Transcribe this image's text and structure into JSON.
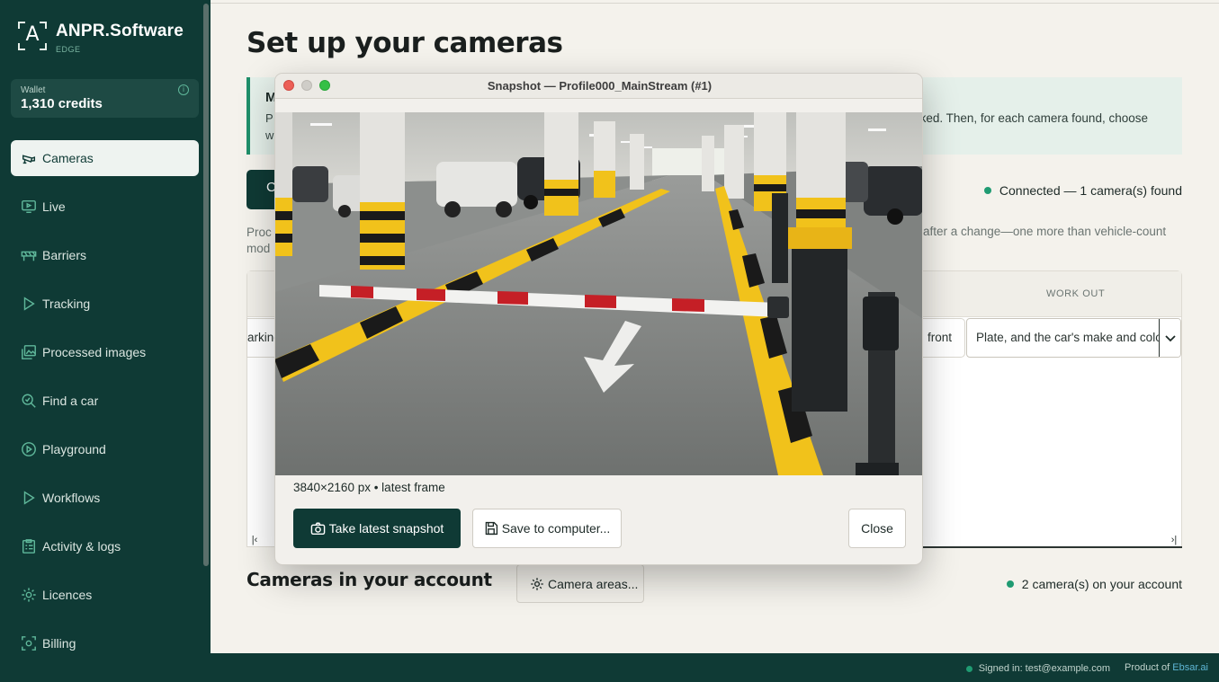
{
  "brand": {
    "name": "ANPR.Software",
    "edition": "EDGE",
    "mark": "A"
  },
  "wallet": {
    "label": "Wallet",
    "value": "1,310 credits",
    "info_icon": "info-icon"
  },
  "nav": [
    {
      "label": "Cameras",
      "icon": "camera-icon",
      "active": true
    },
    {
      "label": "Live",
      "icon": "monitor-play-icon"
    },
    {
      "label": "Barriers",
      "icon": "barrier-icon"
    },
    {
      "label": "Tracking",
      "icon": "play-triangle-icon"
    },
    {
      "label": "Processed images",
      "icon": "images-icon"
    },
    {
      "label": "Find a car",
      "icon": "search-check-icon"
    },
    {
      "label": "Playground",
      "icon": "play-circle-icon"
    },
    {
      "label": "Workflows",
      "icon": "play-triangle-icon"
    },
    {
      "label": "Activity & logs",
      "icon": "clipboard-list-icon"
    },
    {
      "label": "Licences",
      "icon": "gear-icon"
    },
    {
      "label": "Billing",
      "icon": "scan-icon"
    }
  ],
  "page": {
    "title": "Set up your cameras",
    "info_heading": "M",
    "info_line1": "P",
    "info_line2": "w",
    "info_tail": "ked. Then, for each camera found, choose",
    "scan_button_glyph": "C",
    "status": "Connected — 1 camera(s) found",
    "proc_left_1": "Proc",
    "proc_left_2": "mod",
    "proc_right": "after a change—one more than vehicle-count"
  },
  "table": {
    "header_work_out": "WORK OUT",
    "cell_parking": "arking",
    "cell_front": "front",
    "work_out_value": "Plate, and the car's make and colo"
  },
  "account": {
    "title": "Cameras in your account",
    "areas_button": "Camera areas...",
    "count": "2 camera(s) on your account"
  },
  "footer": {
    "signed_in": "Signed in: test@example.com",
    "product_prefix": "Product of ",
    "product_link": "Ebsar.ai"
  },
  "modal": {
    "title": "Snapshot — Profile000_MainStream (#1)",
    "dimensions": "3840×2160 px • latest frame",
    "take_button": "Take latest snapshot",
    "save_button": "Save to computer...",
    "close_button": "Close"
  },
  "colors": {
    "sidebar": "#0f3a35",
    "accent_green": "#1f9b72",
    "background": "#f4f2ec"
  }
}
